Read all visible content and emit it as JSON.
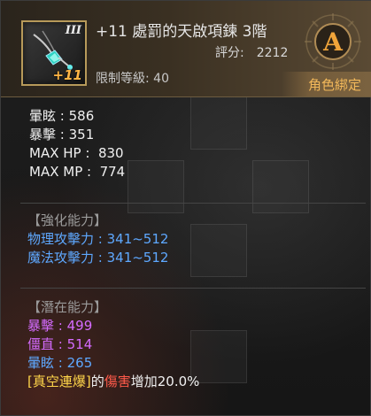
{
  "item": {
    "name": "+11 處罰的天啟項鍊 3階",
    "score_label": "評分:",
    "score_value": "2212",
    "level_label": "限制等級: 40",
    "tier": "III",
    "enhance": "+11",
    "grade": "A",
    "bind": "角色綁定"
  },
  "stats": [
    {
      "name": "暈眩",
      "sep": " : ",
      "value": "586"
    },
    {
      "name": "暴擊",
      "sep": " : ",
      "value": "351"
    },
    {
      "name": "MAX HP",
      "sep": " :  ",
      "value": "830"
    },
    {
      "name": "MAX MP",
      "sep": " :  ",
      "value": "774"
    }
  ],
  "enhancement": {
    "title": "【強化能力】",
    "lines": [
      {
        "name": "物理攻擊力",
        "value": " : 341~512"
      },
      {
        "name": "魔法攻擊力",
        "value": " : 341~512"
      }
    ]
  },
  "potential": {
    "title": "【潛在能力】",
    "lines": [
      {
        "name": "暴擊",
        "value": " : 499"
      },
      {
        "name": "僵直",
        "value": " : 514"
      },
      {
        "name": "暈眩",
        "value": " : 265"
      }
    ],
    "special": {
      "skill": "[真空連爆]",
      "mid": "的",
      "target": "傷害",
      "effect": "增加20.0%"
    }
  },
  "colors": {
    "header_border": "#b79a5a",
    "enhance_text": "#ffb545",
    "bind_text": "#f2b85a",
    "enhancement_blue": "#5ea8ff",
    "potential_purple": "#d56bff",
    "potential_blue": "#5ea8ff",
    "skill_yellow": "#ffd54a",
    "damage_red": "#ff5a4a"
  }
}
